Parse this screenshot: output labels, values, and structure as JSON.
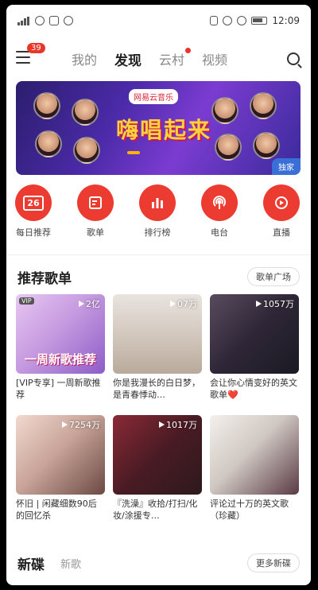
{
  "status_bar": {
    "time": "12:09"
  },
  "header": {
    "badge_count": "39",
    "tabs": [
      {
        "label": "我的"
      },
      {
        "label": "发现"
      },
      {
        "label": "云村"
      },
      {
        "label": "视频"
      }
    ]
  },
  "banner": {
    "logo_text": "网易云音乐",
    "title": "嗨唱起来",
    "tag": "独家"
  },
  "quick_nav": [
    {
      "label": "每日推荐",
      "icon": "calendar-icon",
      "icon_text": "26"
    },
    {
      "label": "歌单",
      "icon": "playlist-icon"
    },
    {
      "label": "排行榜",
      "icon": "chart-icon"
    },
    {
      "label": "电台",
      "icon": "radio-icon"
    },
    {
      "label": "直播",
      "icon": "live-icon"
    }
  ],
  "recommended": {
    "title": "推荐歌单",
    "more_label": "歌单广场",
    "playlists": [
      {
        "title": "[VIP专享] 一周新歌推荐",
        "plays": "2亿",
        "cover_text": "一周新歌推荐",
        "vip_tag": "VIP"
      },
      {
        "title": "你是我漫长的白日梦，是青春悸动…",
        "plays": "07万"
      },
      {
        "title": "会让你心情变好的英文歌单❤️",
        "plays": "1057万"
      },
      {
        "title": "怀旧 | 闲藏细数90后的回忆杀",
        "plays": "7254万"
      },
      {
        "title": "『洗澡』收拾/打扫/化妆/涂援专…",
        "plays": "1017万"
      },
      {
        "title": "评论过十万的英文歌（珍藏）",
        "plays": ""
      }
    ]
  },
  "new_disc": {
    "title": "新碟",
    "alt_tab": "新歌",
    "more_label": "更多新碟"
  },
  "colors": {
    "accent": "#ec3b30",
    "badge": "#e8372a"
  }
}
